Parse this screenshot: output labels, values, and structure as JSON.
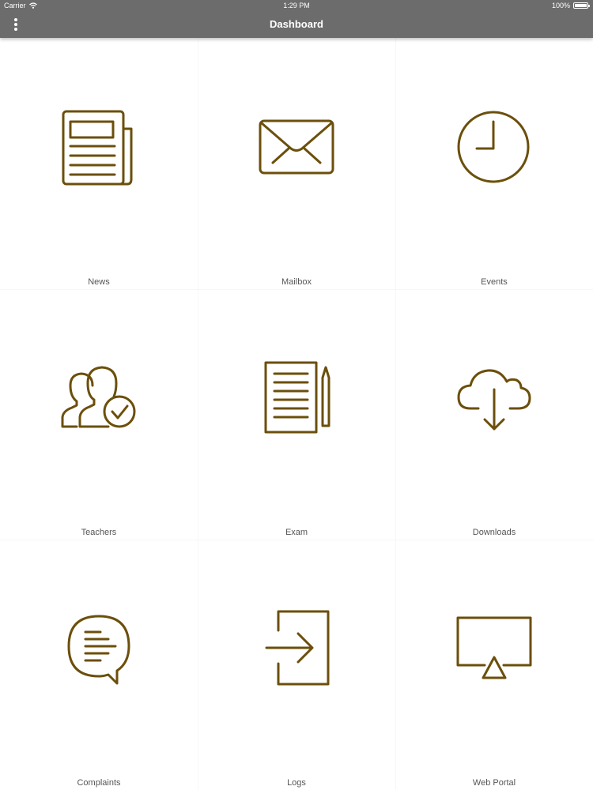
{
  "status_bar": {
    "carrier": "Carrier",
    "time": "1:29 PM",
    "battery": "100%",
    "battery_level": 1.0
  },
  "header": {
    "title": "Dashboard",
    "menu_icon": "more-vertical-icon"
  },
  "colors": {
    "header_bg": "#6d6c6d",
    "icon_stroke": "#6b4f0b",
    "label_text": "#555555"
  },
  "tiles": [
    {
      "label": "News",
      "icon": "newspaper-icon"
    },
    {
      "label": "Mailbox",
      "icon": "envelope-icon"
    },
    {
      "label": "Events",
      "icon": "clock-icon"
    },
    {
      "label": "Teachers",
      "icon": "users-check-icon"
    },
    {
      "label": "Exam",
      "icon": "document-pencil-icon"
    },
    {
      "label": "Downloads",
      "icon": "cloud-download-icon"
    },
    {
      "label": "Complaints",
      "icon": "chat-bubble-icon"
    },
    {
      "label": "Logs",
      "icon": "login-icon"
    },
    {
      "label": "Web Portal",
      "icon": "airplay-icon"
    }
  ]
}
